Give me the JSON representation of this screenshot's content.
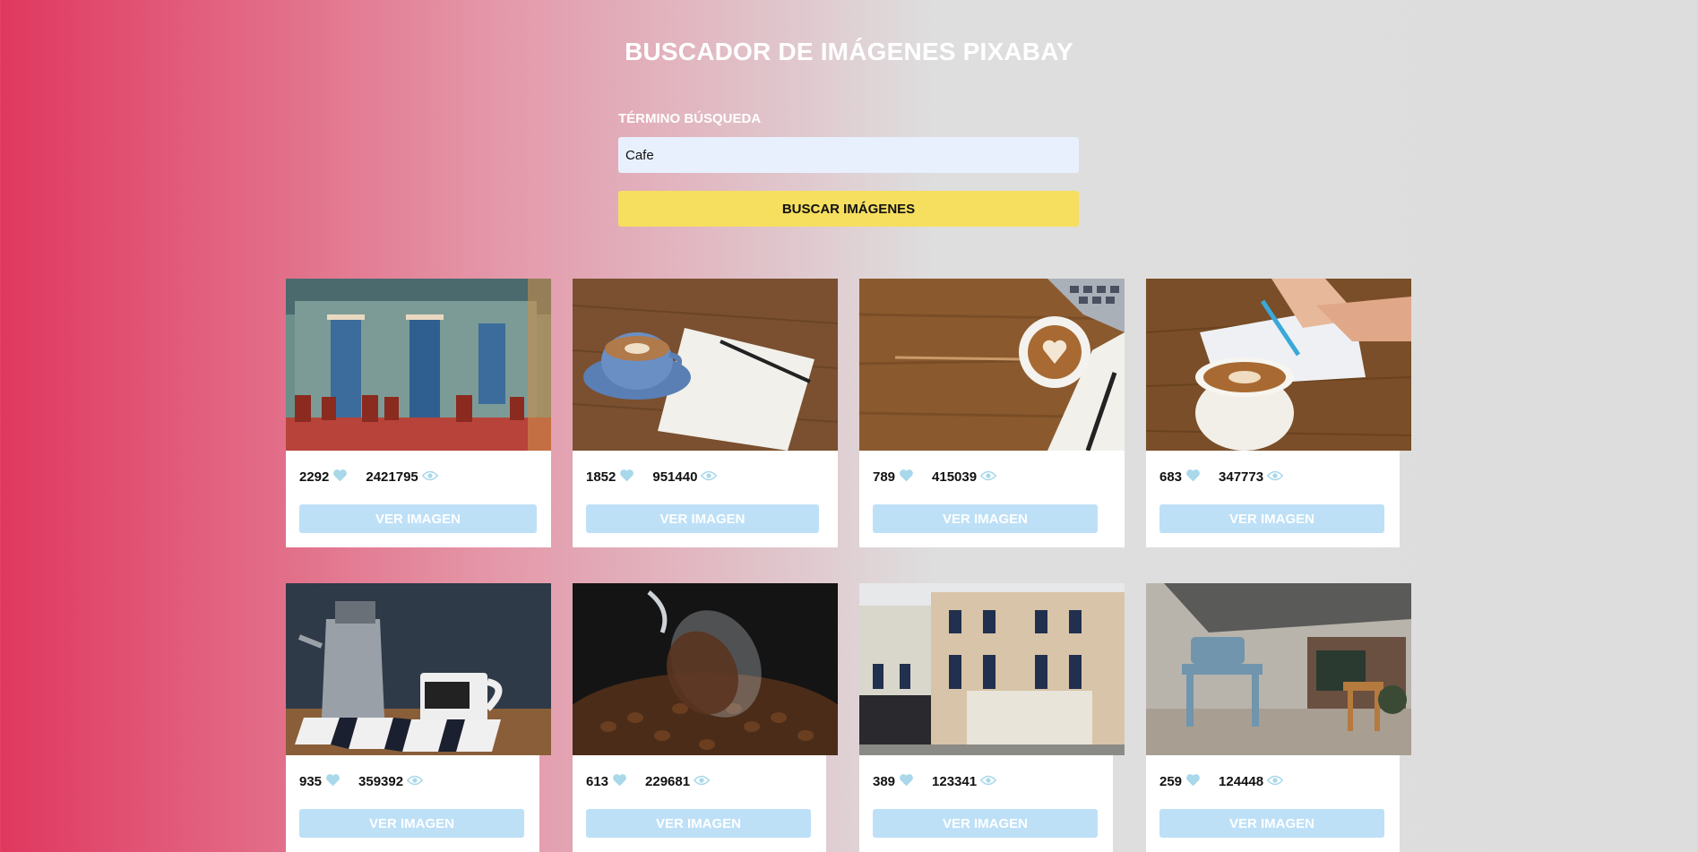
{
  "header": {
    "title": "BUSCADOR DE IMÁGENES PIXABAY"
  },
  "search": {
    "label": "TÉRMINO BÚSQUEDA",
    "value": "Cafe",
    "button_label": "BUSCAR IMÁGENES"
  },
  "colors": {
    "accent_button": "#f6df5f",
    "ver_button": "#bde0f7",
    "icon": "#a8d8ea",
    "gradient_start": "#e0385f"
  },
  "icons": {
    "likes": "heart-icon",
    "views": "eye-icon"
  },
  "results": [
    {
      "likes": "2292",
      "views": "2421795",
      "button": "VER IMAGEN",
      "subject": "street-cafe-facade"
    },
    {
      "likes": "1852",
      "views": "951440",
      "button": "VER IMAGEN",
      "subject": "coffee-cup-notebook"
    },
    {
      "likes": "789",
      "views": "415039",
      "button": "VER IMAGEN",
      "subject": "latte-on-desk"
    },
    {
      "likes": "683",
      "views": "347773",
      "button": "VER IMAGEN",
      "subject": "latte-writing-hand"
    },
    {
      "likes": "935",
      "views": "359392",
      "button": "VER IMAGEN",
      "subject": "coffee-pot-mug"
    },
    {
      "likes": "613",
      "views": "229681",
      "button": "VER IMAGEN",
      "subject": "coffee-beans-glass"
    },
    {
      "likes": "389",
      "views": "123341",
      "button": "VER IMAGEN",
      "subject": "hotel-restaurant"
    },
    {
      "likes": "259",
      "views": "124448",
      "button": "VER IMAGEN",
      "subject": "cafe-terrace-chairs"
    }
  ]
}
